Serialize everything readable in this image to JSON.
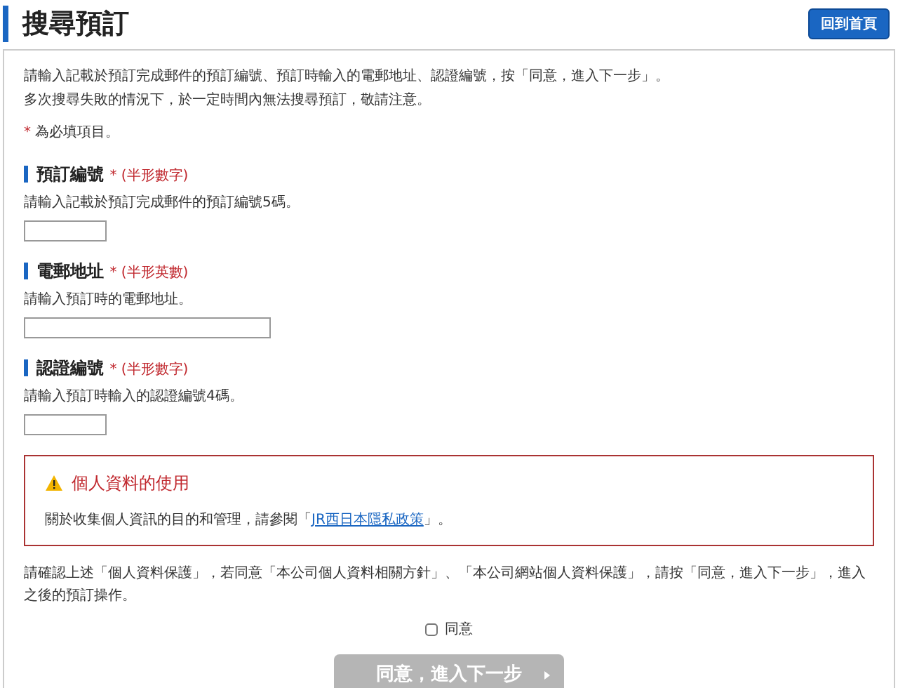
{
  "page": {
    "title": "搜尋預訂",
    "home_button": "回到首頁"
  },
  "intro": [
    "請輸入記載於預訂完成郵件的預訂編號、預訂時輸入的電郵地址、認證編號，按「同意，進入下一步」。",
    "多次搜尋失敗的情況下，於一定時間內無法搜尋預訂，敬請注意。"
  ],
  "required_note": {
    "mark": "*",
    "text": "為必填項目。"
  },
  "fields": [
    {
      "label": "預訂編號",
      "mark": "*",
      "hint": "(半形數字)",
      "description": "請輸入記載於預訂完成郵件的預訂編號5碼。",
      "kind": "short"
    },
    {
      "label": "電郵地址",
      "mark": "*",
      "hint": "(半形英數)",
      "description": "請輸入預訂時的電郵地址。",
      "kind": "long"
    },
    {
      "label": "認證編號",
      "mark": "*",
      "hint": "(半形數字)",
      "description": "請輸入預訂時輸入的認證編號4碼。",
      "kind": "short"
    }
  ],
  "privacy": {
    "title": "個人資料的使用",
    "text_before": "關於收集個人資訊的目的和管理，請參閱「",
    "link": "JR西日本隱私政策",
    "text_after": "」。"
  },
  "consent_text": "請確認上述「個人資料保護」，若同意「本公司個人資料相關方針」、「本公司網站個人資料保護」，請按「同意，進入下一步」，進入之後的預訂操作。",
  "agree": {
    "label": "同意",
    "checked": false
  },
  "next_button": {
    "label": "同意，進入下一步",
    "disabled": true
  }
}
